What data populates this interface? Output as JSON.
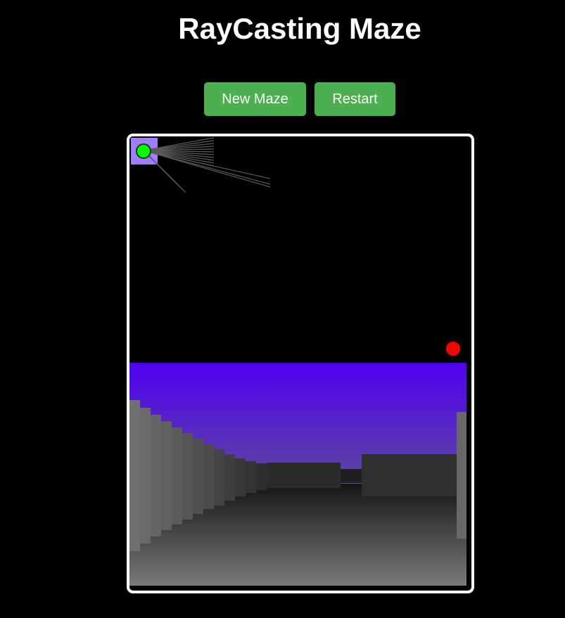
{
  "title": "RayCasting Maze",
  "controls": {
    "new_maze_label": "New Maze",
    "restart_label": "Restart"
  },
  "game": {
    "colors": {
      "player": "#00ff00",
      "goal": "#ff0000",
      "start_cell": "#a07cff",
      "sky_top": "#4f00f2",
      "sky_bottom": "#5e4a9a",
      "wall": "#6c6c6c",
      "floor_far": "#1a1a1a",
      "floor_near": "#7a7a7a"
    }
  }
}
